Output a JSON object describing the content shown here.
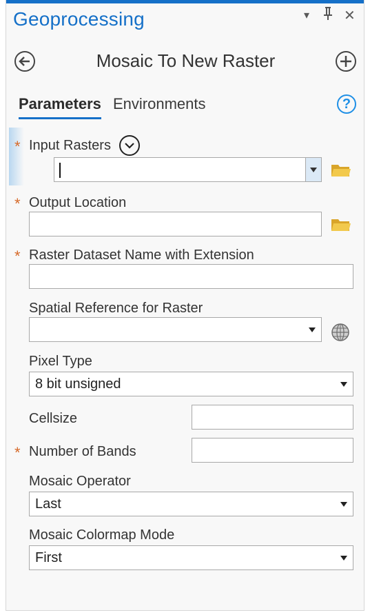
{
  "pane": {
    "title": "Geoprocessing",
    "controls": {
      "menu": "▾",
      "pin": "ᴨ",
      "close": "✕"
    }
  },
  "tool": {
    "title": "Mosaic To New Raster",
    "back_icon": "back-arrow-icon",
    "add_icon": "add-icon"
  },
  "tabs": {
    "parameters": "Parameters",
    "environments": "Environments",
    "help": "?"
  },
  "params": {
    "input_rasters": {
      "label": "Input Rasters",
      "required": "*",
      "value": ""
    },
    "output_location": {
      "label": "Output Location",
      "required": "*",
      "value": ""
    },
    "raster_name": {
      "label": "Raster Dataset Name with Extension",
      "required": "*",
      "value": ""
    },
    "spatial_reference": {
      "label": "Spatial Reference for  Raster",
      "value": ""
    },
    "pixel_type": {
      "label": "Pixel Type",
      "value": "8 bit unsigned"
    },
    "cellsize": {
      "label": "Cellsize",
      "value": ""
    },
    "num_bands": {
      "label": "Number of Bands",
      "required": "*",
      "value": ""
    },
    "mosaic_operator": {
      "label": "Mosaic Operator",
      "value": "Last"
    },
    "colormap_mode": {
      "label": "Mosaic Colormap Mode",
      "value": "First"
    }
  },
  "colors": {
    "accent": "#1570c8",
    "required": "#d66a2a",
    "folder": "#e8b93b"
  }
}
